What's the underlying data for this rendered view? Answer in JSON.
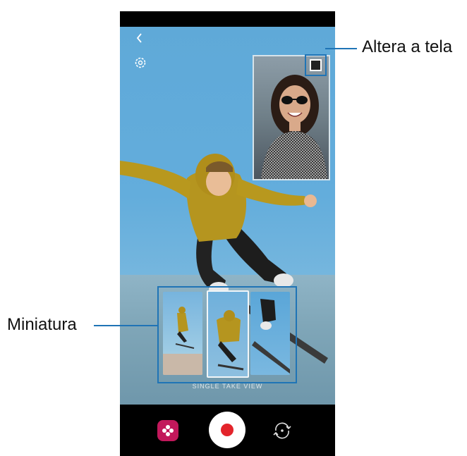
{
  "callouts": {
    "swap_screen": "Altera a tela",
    "thumbnail": "Miniatura"
  },
  "camera": {
    "mode_label": "SINGLE TAKE VIEW"
  },
  "icons": {
    "back": "chevron-left-icon",
    "settings": "gear-icon",
    "swap": "swap-screen-icon",
    "effects": "flower-effects-icon",
    "record": "record-icon",
    "flip": "switch-camera-icon"
  },
  "colors": {
    "callout_accent": "#1f74b6",
    "record_dot": "#e3242b",
    "effects_button": "#c2185b"
  }
}
